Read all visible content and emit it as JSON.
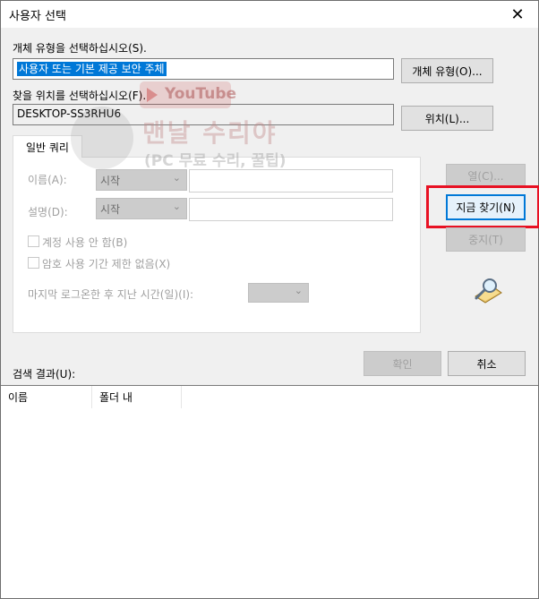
{
  "window": {
    "title": "사용자 선택",
    "close_glyph": "✕"
  },
  "object_type": {
    "label": "개체 유형을 선택하십시오(S).",
    "value": "사용자 또는 기본 제공 보안 주체",
    "button": "개체 유형(O)..."
  },
  "location": {
    "label": "찾을 위치를 선택하십시오(F).",
    "value": "DESKTOP-SS3RHU6",
    "button": "위치(L)..."
  },
  "common_query": {
    "tab_label": "일반 쿼리",
    "name_label": "이름(A):",
    "name_mode": "시작",
    "desc_label": "설명(D):",
    "desc_mode": "시작",
    "disabled_accounts_label": "계정 사용 안 함(B)",
    "no_expire_label": "암호 사용 기간 제한 없음(X)",
    "last_logon_label": "마지막 로그온한 후 지난 시간(일)(I):"
  },
  "side_buttons": {
    "columns": "열(C)...",
    "find_now": "지금 찾기(N)",
    "stop": "중지(T)"
  },
  "footer": {
    "ok": "확인",
    "cancel": "취소",
    "results_label": "검색 결과(U):"
  },
  "results": {
    "columns": [
      "이름",
      "폴더 내"
    ]
  },
  "watermark": {
    "youtube": "YouTube",
    "channel": "맨날 수리야",
    "subtitle": "(PC 무료 수리, 꿀팁)"
  },
  "colors": {
    "highlight": "#e81123",
    "selection": "#0078d7"
  }
}
